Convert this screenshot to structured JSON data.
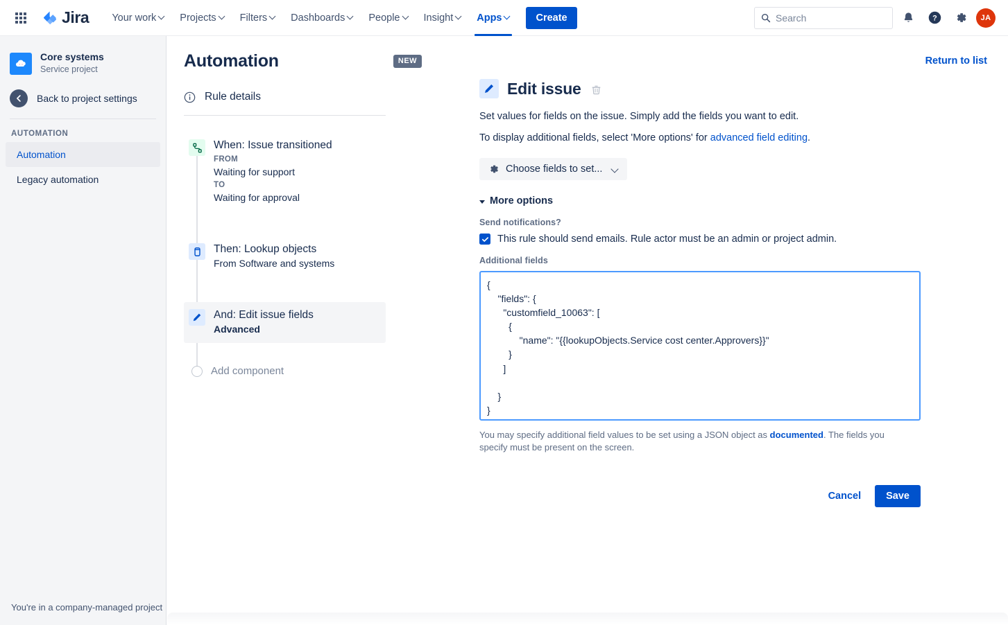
{
  "topnav": {
    "app_switcher_icon": "grid-apps-icon",
    "logo_text": "Jira",
    "items": [
      {
        "label": "Your work",
        "has_chevron": true,
        "active": false
      },
      {
        "label": "Projects",
        "has_chevron": true,
        "active": false
      },
      {
        "label": "Filters",
        "has_chevron": true,
        "active": false
      },
      {
        "label": "Dashboards",
        "has_chevron": true,
        "active": false
      },
      {
        "label": "People",
        "has_chevron": true,
        "active": false
      },
      {
        "label": "Insight",
        "has_chevron": true,
        "active": false
      },
      {
        "label": "Apps",
        "has_chevron": true,
        "active": true
      }
    ],
    "create_label": "Create",
    "search_placeholder": "Search",
    "icons": [
      "notifications-icon",
      "help-icon",
      "settings-icon"
    ],
    "avatar_initials": "JA",
    "avatar_color": "#DE350B",
    "accent_color": "#0052CC"
  },
  "sidebar": {
    "project_name": "Core systems",
    "project_type": "Service project",
    "back_label": "Back to project settings",
    "section_label": "AUTOMATION",
    "items": [
      {
        "label": "Automation",
        "active": true
      },
      {
        "label": "Legacy automation",
        "active": false
      }
    ],
    "footer": "You're in a company-managed project"
  },
  "rule_panel": {
    "title": "Automation",
    "badge": "NEW",
    "rule_details_label": "Rule details",
    "steps": [
      {
        "title": "When: Issue transitioned",
        "icon": "branch-transition-icon",
        "icon_tone": "green",
        "selected": false,
        "meta": [
          {
            "text": "FROM",
            "style": "label"
          },
          {
            "text": "Waiting for support",
            "style": "value"
          },
          {
            "text": "TO",
            "style": "label"
          },
          {
            "text": "Waiting for approval",
            "style": "value"
          }
        ]
      },
      {
        "title": "Then: Lookup objects",
        "icon": "database-icon",
        "icon_tone": "blue",
        "selected": false,
        "meta": [
          {
            "text": "From Software and systems",
            "style": "value"
          }
        ]
      },
      {
        "title": "And: Edit issue fields",
        "icon": "pencil-icon",
        "icon_tone": "blue",
        "selected": true,
        "meta": [
          {
            "text": "Advanced",
            "style": "bold"
          }
        ]
      }
    ],
    "add_component_label": "Add component"
  },
  "main": {
    "return_to_list": "Return to list",
    "heading": "Edit issue",
    "delete_icon": "trash-icon",
    "description_1": "Set values for fields on the issue. Simply add the fields you want to edit.",
    "description_2_prefix": "To display additional fields, select 'More options' for ",
    "description_2_link": "advanced field editing",
    "description_2_suffix": ".",
    "choose_fields_label": "Choose fields to set...",
    "choose_fields_icon": "gear-icon",
    "more_options_label": "More options",
    "send_notifications_label": "Send notifications?",
    "send_notifications_checked": true,
    "send_notifications_text": "This rule should send emails. Rule actor must be an admin or project admin.",
    "additional_fields_label": "Additional fields",
    "additional_fields_value": "{\n    \"fields\": {\n      \"customfield_10063\": [\n        {\n            \"name\": \"{{lookupObjects.Service cost center.Approvers}}\"\n        }\n      ]\n\n    }\n}",
    "help_prefix": "You may specify additional field values to be set using a JSON object as ",
    "help_link": "documented",
    "help_suffix": ". The fields you specify must be present on the screen.",
    "cancel_label": "Cancel",
    "save_label": "Save"
  }
}
